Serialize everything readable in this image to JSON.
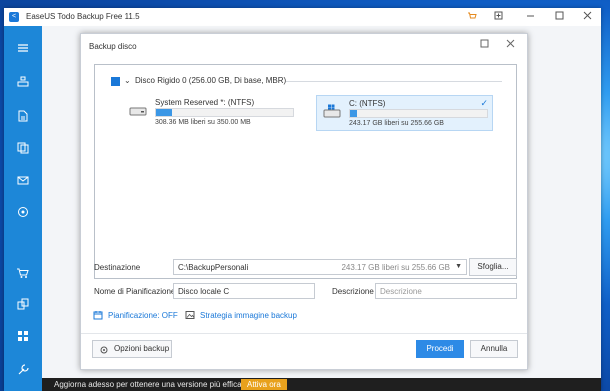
{
  "window": {
    "title": "EaseUS Todo Backup Free 11.5",
    "logo_letter": "<",
    "controls": [
      "cart-icon",
      "expand-icon",
      "minimize-icon",
      "maximize-icon",
      "close-icon"
    ]
  },
  "sidebar": {
    "items": [
      "menu-icon",
      "disk-backup-icon",
      "file-backup-icon",
      "clone-icon",
      "mail-backup-icon",
      "system-icon",
      "cart-icon",
      "copy-icon",
      "apps-icon",
      "tools-icon"
    ]
  },
  "promo": {
    "text": "Aggiorna adesso per ottenere una versione più efficace",
    "button": "Attiva ora"
  },
  "dialog": {
    "title": "Backup disco",
    "disk": {
      "label": "Disco Rigido 0 (256.00 GB, Di base, MBR)",
      "partitions": [
        {
          "name": "System Reserved *: (NTFS)",
          "info": "308.36 MB liberi su 350.00 MB",
          "used_fraction": 0.12,
          "selected": false
        },
        {
          "name": "C: (NTFS)",
          "info": "243.17 GB liberi su 255.66 GB",
          "used_fraction": 0.05,
          "selected": true
        }
      ]
    },
    "form": {
      "destination_label": "Destinazione",
      "destination_value": "C:\\BackupPersonali",
      "destination_free": "243.17 GB liberi su 255.66 GB",
      "browse_label": "Sfoglia...",
      "plan_label": "Nome di Pianificazione",
      "plan_value": "Disco locale C",
      "description_label": "Descrizione",
      "description_placeholder": "Descrizione"
    },
    "links": {
      "schedule": "Pianificazione:  OFF",
      "strategy": "Strategia immagine backup"
    },
    "buttons": {
      "options": "Opzioni backup",
      "proceed": "Procedi",
      "cancel": "Annulla"
    }
  },
  "colors": {
    "accent": "#2d8ae6",
    "sidebar": "#1d87d8",
    "promo_button": "#e8a11d"
  }
}
